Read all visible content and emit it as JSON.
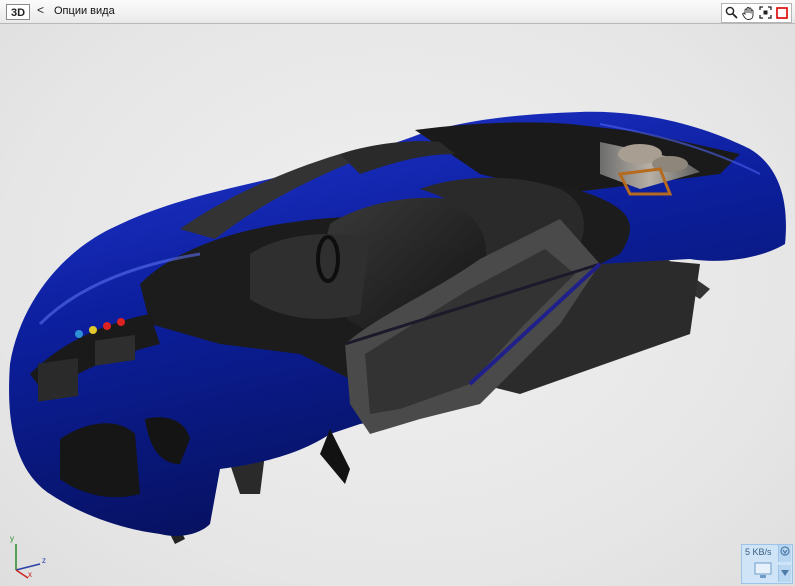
{
  "toolbar": {
    "mode_label": "3D",
    "back_label": "<",
    "title": "Опции вида",
    "zoom_icon": "magnifier-icon",
    "pan_icon": "hand-icon",
    "fit_icon": "fit-frame-icon",
    "record_icon": "red-square-icon"
  },
  "viewport": {
    "model": "car-3d-model",
    "colors": {
      "body": "#0a1f9c",
      "interior": "#1e1e1e",
      "background": "#e8e8e8"
    }
  },
  "axis": {
    "y_label": "y",
    "z_label": "z",
    "x_label": "x"
  },
  "network": {
    "rate": "5 KB/s"
  }
}
